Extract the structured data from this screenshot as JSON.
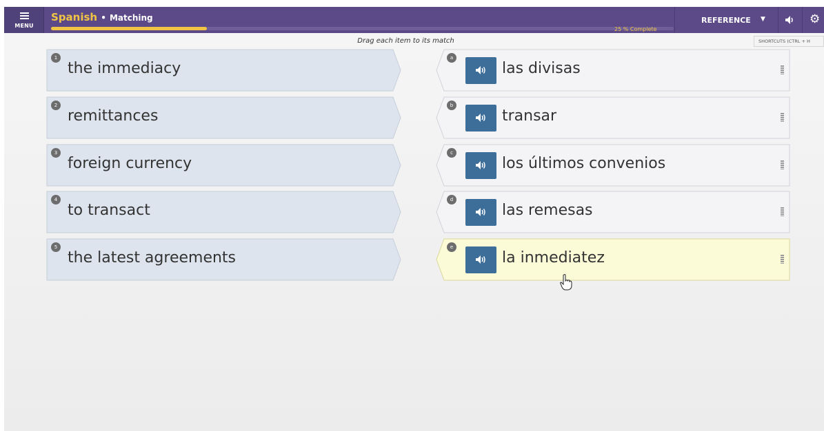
{
  "header": {
    "menu_label": "MENU",
    "language": "Spanish",
    "separator": "•",
    "mode": "Matching",
    "progress_text": "25 % Complete",
    "progress_fraction": 0.25,
    "reference_label": "REFERENCE",
    "shortcuts_label": "SHORTCUTS (CTRL + H",
    "colors": {
      "bar": "#5b4a87",
      "accent": "#f1c544"
    }
  },
  "instruction": "Drag each item to its match",
  "left_items": [
    {
      "num": "1",
      "text": "the immediacy"
    },
    {
      "num": "2",
      "text": "remittances"
    },
    {
      "num": "3",
      "text": "foreign currency"
    },
    {
      "num": "4",
      "text": "to transact"
    },
    {
      "num": "5",
      "text": "the latest agreements"
    }
  ],
  "right_items": [
    {
      "letter": "a",
      "text": "las divisas"
    },
    {
      "letter": "b",
      "text": "transar"
    },
    {
      "letter": "c",
      "text": "los últimos convenios"
    },
    {
      "letter": "d",
      "text": "las remesas"
    },
    {
      "letter": "e",
      "text": "la inmediatez",
      "highlighted": true
    }
  ],
  "icons": [
    "menu-icon",
    "sound-icon",
    "gear-icon",
    "caret-down-icon",
    "grip-icon",
    "hand-cursor-icon"
  ]
}
